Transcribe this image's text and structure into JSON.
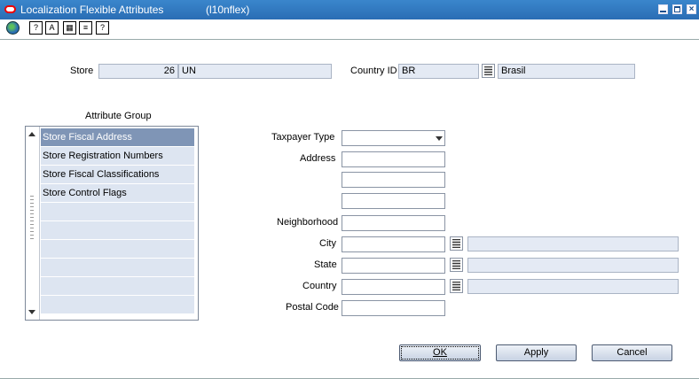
{
  "window": {
    "title": "Localization Flexible Attributes",
    "module": "(l10nflex)"
  },
  "toolbar": {
    "icons": [
      "globe-icon",
      "help-topics-icon",
      "keyboard-icon",
      "calendar-icon",
      "document-icon",
      "help-icon"
    ]
  },
  "header": {
    "store_label": "Store",
    "store_id": "26",
    "store_name": "UN",
    "country_label": "Country ID",
    "country_id": "BR",
    "country_name": "Brasil"
  },
  "attribute_group": {
    "heading": "Attribute Group",
    "items": [
      {
        "label": "Store Fiscal Address",
        "selected": true
      },
      {
        "label": "Store Registration Numbers",
        "selected": false
      },
      {
        "label": "Store Fiscal Classifications",
        "selected": false
      },
      {
        "label": "Store Control Flags",
        "selected": false
      },
      {
        "label": "",
        "selected": false
      },
      {
        "label": "",
        "selected": false
      },
      {
        "label": "",
        "selected": false
      },
      {
        "label": "",
        "selected": false
      },
      {
        "label": "",
        "selected": false
      },
      {
        "label": "",
        "selected": false
      }
    ]
  },
  "form": {
    "taxpayer_type_label": "Taxpayer Type",
    "taxpayer_type_value": "",
    "address_label": "Address",
    "address_line1": "",
    "address_line2": "",
    "address_line3": "",
    "neighborhood_label": "Neighborhood",
    "neighborhood_value": "",
    "city_label": "City",
    "city_value": "",
    "city_desc": "",
    "state_label": "State",
    "state_value": "",
    "state_desc": "",
    "country_label": "Country",
    "country_value": "",
    "country_desc": "",
    "postal_code_label": "Postal Code",
    "postal_code_value": ""
  },
  "buttons": {
    "ok_label": "OK",
    "apply_label": "Apply",
    "cancel_label": "Cancel"
  },
  "colors": {
    "titlebar": "#2a6db4",
    "selected_row": "#7f95b6",
    "readonly_field": "#e4eaf4"
  }
}
